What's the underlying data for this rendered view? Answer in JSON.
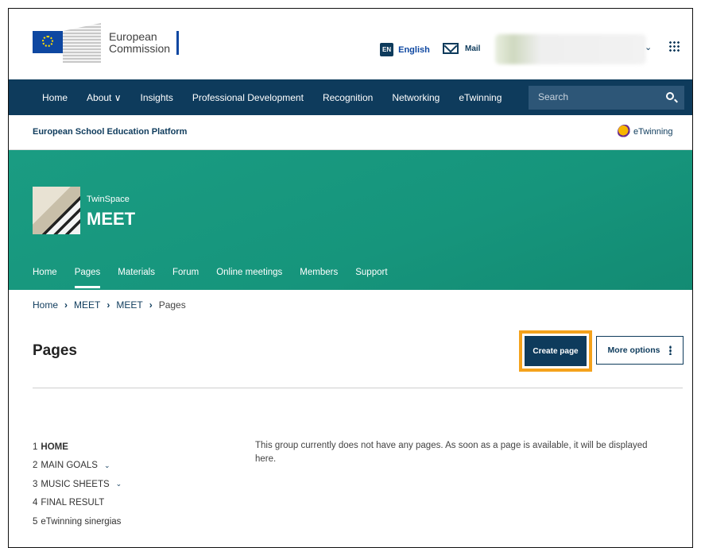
{
  "header": {
    "logo_line1": "European",
    "logo_line2": "Commission",
    "lang_code": "EN",
    "lang_label": "English",
    "mail_label": "Mail"
  },
  "mainnav": {
    "items": [
      "Home",
      "About ∨",
      "Insights",
      "Professional Development",
      "Recognition",
      "Networking",
      "eTwinning"
    ],
    "search_placeholder": "Search"
  },
  "platform": {
    "title": "European School Education Platform",
    "etwinning_label": "eTwinning"
  },
  "hero": {
    "space_label": "TwinSpace",
    "name": "MEET",
    "tabs": [
      "Home",
      "Pages",
      "Materials",
      "Forum",
      "Online meetings",
      "Members",
      "Support"
    ]
  },
  "breadcrumb": [
    "Home",
    "MEET",
    "MEET",
    "Pages"
  ],
  "page": {
    "title": "Pages",
    "create_button": "Create page",
    "more_button": "More options",
    "empty_message": "This group currently does not have any pages. As soon as a page is available, it will be displayed here."
  },
  "pagelist": [
    {
      "num": "1",
      "label": "HOME"
    },
    {
      "num": "2",
      "label": "MAIN GOALS"
    },
    {
      "num": "3",
      "label": "MUSIC SHEETS"
    },
    {
      "num": "4",
      "label": "FINAL RESULT"
    },
    {
      "num": "5",
      "label": "eTwinning sinergias"
    }
  ],
  "colors": {
    "navy": "#0e3b5c",
    "teal": "#1a9c82",
    "highlight": "#f4a21c"
  }
}
